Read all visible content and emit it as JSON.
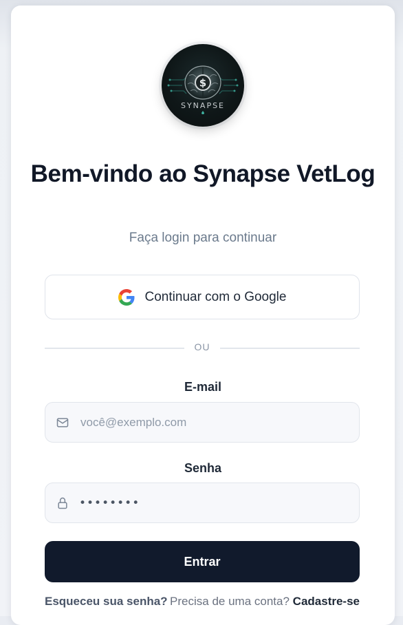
{
  "brand": {
    "logo_text": "SYNAPSE"
  },
  "header": {
    "title": "Bem-vindo ao Synapse VetLog",
    "subtitle": "Faça login para continuar"
  },
  "google": {
    "label": "Continuar com o Google",
    "icon": "google-icon"
  },
  "divider": {
    "text": "OU"
  },
  "email": {
    "label": "E-mail",
    "placeholder": "você@exemplo.com",
    "icon": "mail-icon"
  },
  "password": {
    "label": "Senha",
    "value_masked": "••••••••",
    "icon": "lock-icon"
  },
  "submit": {
    "label": "Entrar"
  },
  "footer": {
    "forgot_label": "Esqueceu sua senha?",
    "signup_prompt": "Precisa de uma conta?",
    "signup_label": "Cadastre-se"
  },
  "colors": {
    "primary": "#111a2c",
    "text": "#111827",
    "muted": "#6b7a8c",
    "field_bg": "#f7f8fb",
    "border": "#dfe3ea"
  }
}
